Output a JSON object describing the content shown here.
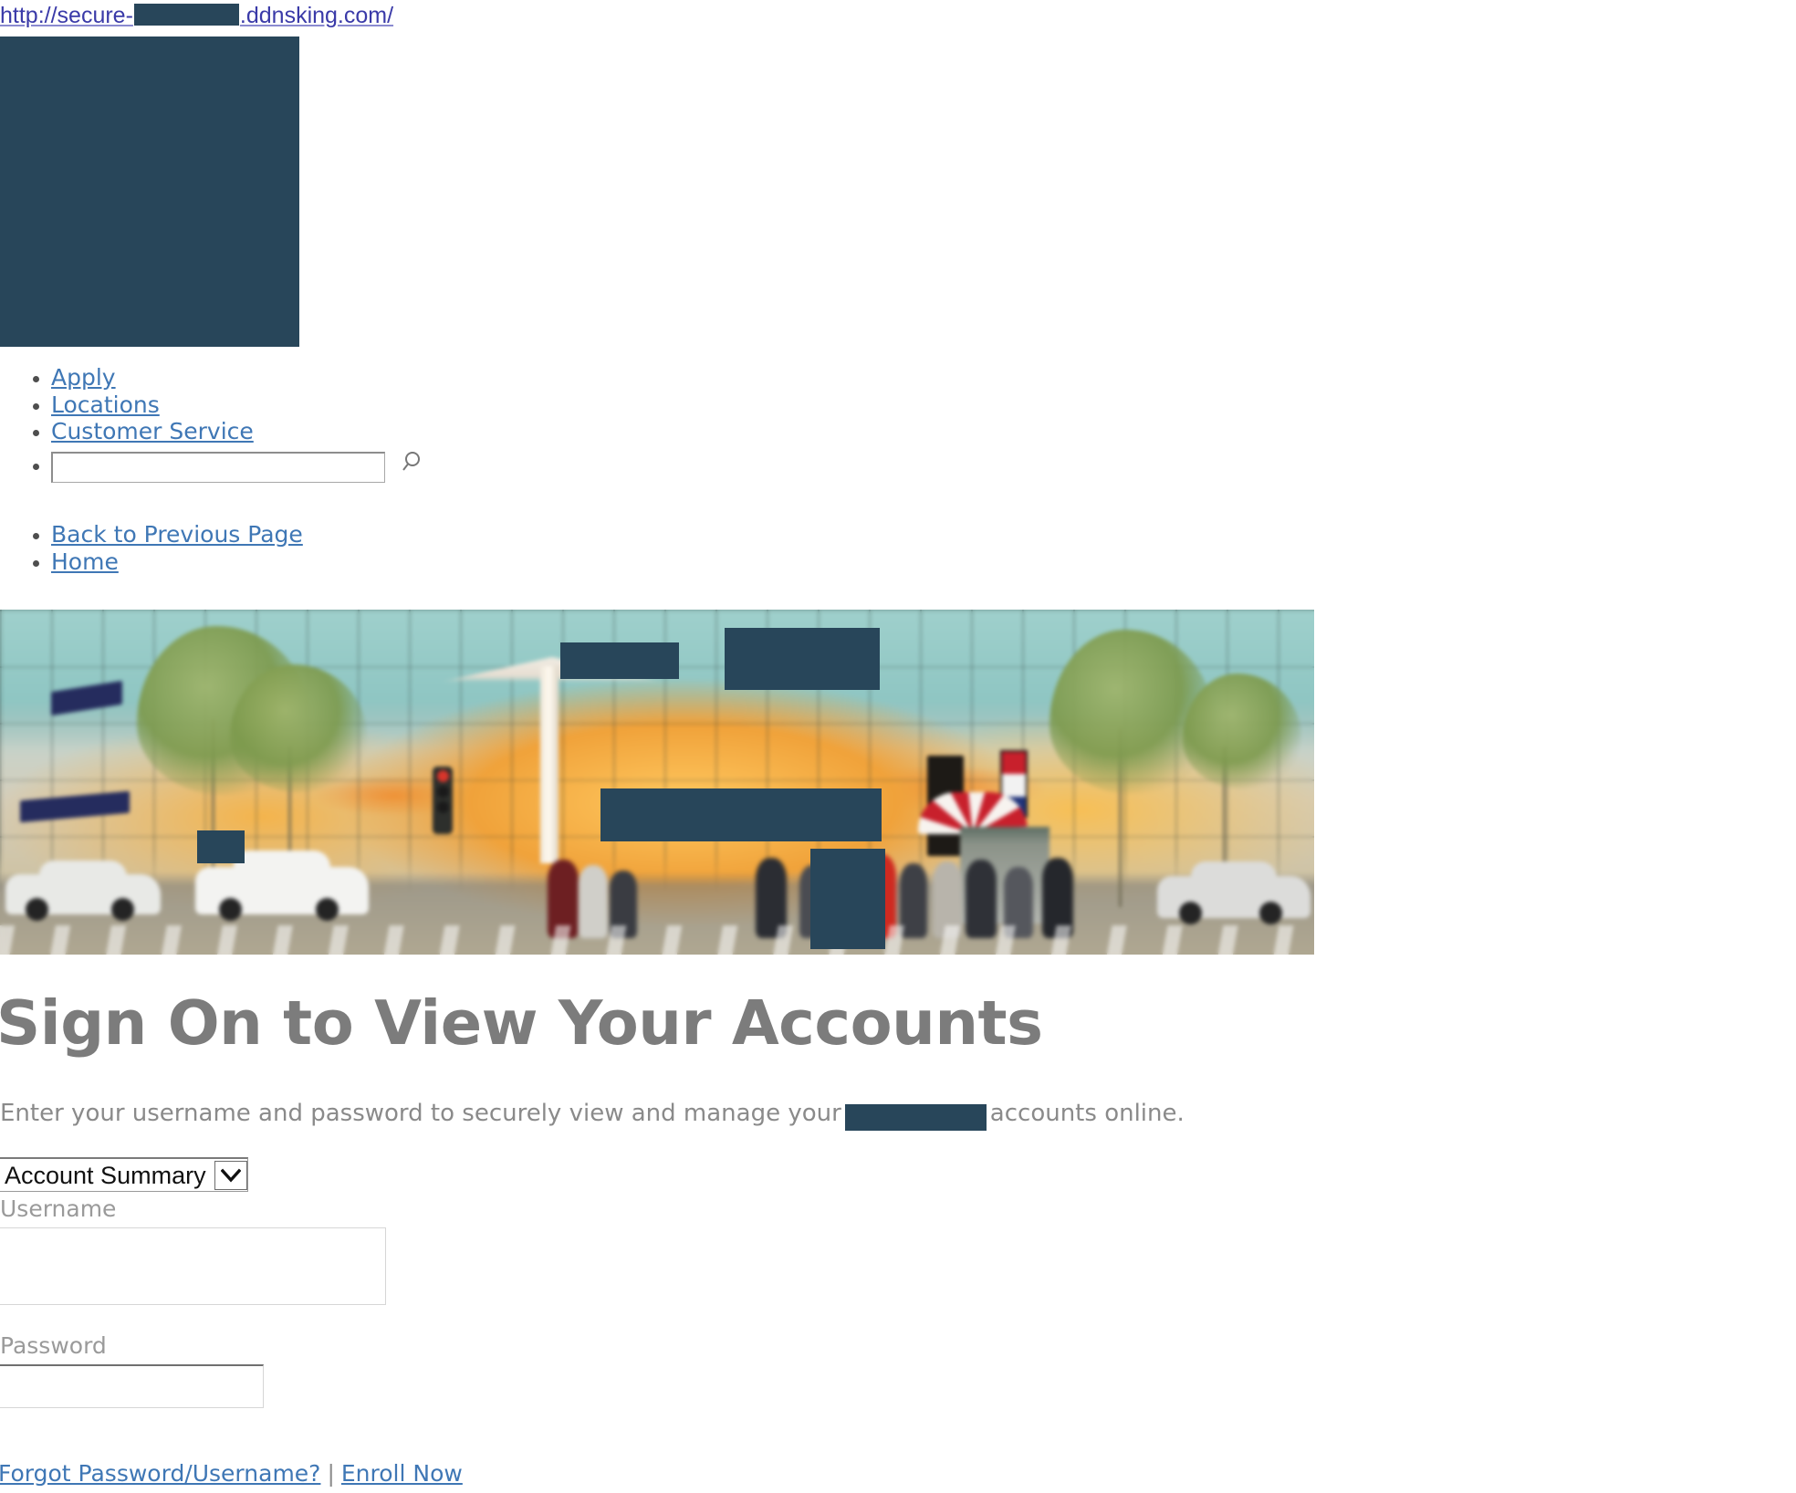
{
  "url_bar": {
    "prefix": "http://secure-",
    "redacted_host": "",
    "suffix": ".ddnsking.com/"
  },
  "branding": {
    "logo_redacted": "",
    "redaction_color": "#28465a"
  },
  "utility_nav": {
    "items": [
      {
        "label": "Apply"
      },
      {
        "label": "Locations"
      },
      {
        "label": "Customer Service"
      }
    ],
    "search": {
      "value": "",
      "placeholder": "",
      "icon": "search-icon"
    }
  },
  "breadcrumb": {
    "items": [
      {
        "label": "Back to Previous Page"
      },
      {
        "label": "Home"
      }
    ]
  },
  "hero": {
    "alt": "City street corner with a glass storefront, trees, pedestrians and cars",
    "redaction_color": "#28465a"
  },
  "main": {
    "title": "Sign On to View Your Accounts",
    "lead_before": "Enter your username and password to securely view and manage your",
    "lead_redacted": "",
    "lead_after": "accounts online.",
    "account_select": {
      "selected": "Account Summary",
      "options": [
        "Account Summary"
      ],
      "chevron_icon": "chevron-down-icon"
    },
    "username": {
      "label": "Username",
      "value": "",
      "placeholder": ""
    },
    "password": {
      "label": "Password",
      "value": "",
      "placeholder": ""
    },
    "footer": {
      "forgot_label": "Forgot Password/Username?",
      "separator": "|",
      "enroll_label": "Enroll Now"
    }
  },
  "colors": {
    "link": "#3f77b5",
    "url_link": "#2b2bb5",
    "heading": "#7c7c7c",
    "body_text": "#8a8a8a",
    "redaction": "#28465a"
  }
}
